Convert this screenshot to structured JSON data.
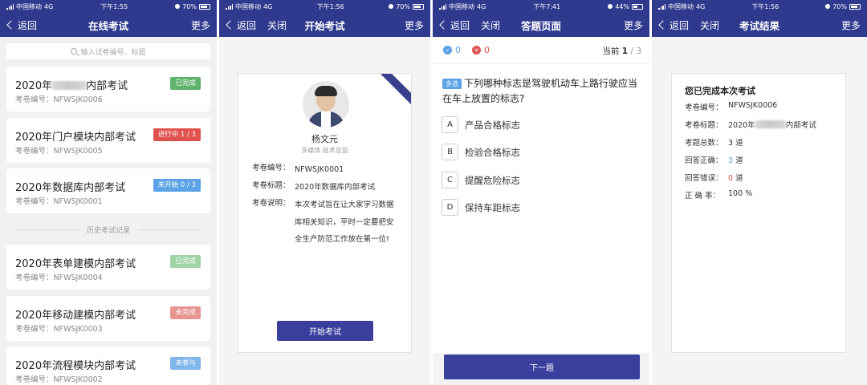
{
  "colors": {
    "primary": "#2f3a8f",
    "button": "#3a3f9e",
    "completed": "#5fb36b",
    "in_progress": "#e0524e",
    "not_started": "#5ba3e6",
    "completed_faded": "#9fd4a6",
    "incomplete": "#e79390",
    "not_attended": "#7fb6ec",
    "correct": "#5ba3e6",
    "wrong": "#e0524e"
  },
  "screens": [
    {
      "status": {
        "carrier": "中国移动",
        "network": "4G",
        "time": "下午1:55",
        "battery": "70%",
        "battery_level": 0.7
      },
      "nav": {
        "back": "返回",
        "title": "在线考试",
        "more": "更多"
      },
      "search": {
        "placeholder": "输入试卷编号、标题"
      },
      "history_label": "历史考试记录",
      "exams": [
        {
          "title_pre": "2020年",
          "title_post": "内部考试",
          "redacted": true,
          "code_label": "考卷编号：",
          "code": "NFWSJK0006",
          "badge": "已完成",
          "badge_color": "#5fb36b"
        },
        {
          "title_pre": "2020年门户模块内部考试",
          "title_post": "",
          "redacted": false,
          "code_label": "考卷编号：",
          "code": "NFWSJK0005",
          "badge": "进行中 1 / 3",
          "badge_color": "#e0524e"
        },
        {
          "title_pre": "2020年数据库内部考试",
          "title_post": "",
          "redacted": false,
          "code_label": "考卷编号：",
          "code": "NFWSJK0001",
          "badge": "未开始 0 / 3",
          "badge_color": "#5ba3e6"
        }
      ],
      "history": [
        {
          "title": "2020年表单建模内部考试",
          "code_label": "考卷编号：",
          "code": "NFWSJK0004",
          "badge": "已完成",
          "badge_color": "#9fd4a6"
        },
        {
          "title": "2020年移动建模内部考试",
          "code_label": "考卷编号：",
          "code": "NFWSJK0003",
          "badge": "未完成",
          "badge_color": "#e79390"
        },
        {
          "title": "2020年流程模块内部考试",
          "code_label": "考卷编号：",
          "code": "NFWSJK0002",
          "badge": "未参与",
          "badge_color": "#7fb6ec"
        }
      ]
    },
    {
      "status": {
        "carrier": "中国移动",
        "network": "4G",
        "time": "下午1:56",
        "battery": "70%",
        "battery_level": 0.7
      },
      "nav": {
        "back": "返回",
        "close": "关闭",
        "title": "开始考试",
        "more": "更多"
      },
      "person": {
        "name": "杨文元",
        "role": "多媒体  技术总监"
      },
      "fields": [
        {
          "label": "考卷编号：",
          "value": "NFWSJK0001"
        },
        {
          "label": "考卷标题：",
          "value": "2020年数据库内部考试"
        },
        {
          "label": "考卷说明：",
          "value": "本次考试旨在让大家学习数据库相关知识，平时一定要把安全生产防范工作放在第一位!"
        }
      ],
      "start_button": "开始考试"
    },
    {
      "status": {
        "carrier": "中国移动",
        "network": "4G",
        "time": "下午7:41",
        "battery": "44%",
        "battery_level": 0.44
      },
      "nav": {
        "back": "返回",
        "close": "关闭",
        "title": "答题页面",
        "more": "更多"
      },
      "score": {
        "correct": "0",
        "wrong": "0",
        "current_label": "当前",
        "current": "1",
        "sep": "/",
        "total": "3"
      },
      "question": {
        "tag": "多选",
        "text": "下列哪种标志是驾驶机动车上路行驶应当在车上放置的标志?"
      },
      "options": [
        {
          "letter": "A",
          "text": "产品合格标志"
        },
        {
          "letter": "B",
          "text": "检验合格标志"
        },
        {
          "letter": "C",
          "text": "提醒危险标志"
        },
        {
          "letter": "D",
          "text": "保持车距标志"
        }
      ],
      "next_button": "下一题"
    },
    {
      "status": {
        "carrier": "中国移动",
        "network": "4G",
        "time": "下午1:56",
        "battery": "70%",
        "battery_level": 0.7
      },
      "nav": {
        "back": "返回",
        "close": "关闭",
        "title": "考试结果",
        "more": "更多"
      },
      "result": {
        "title": "您已完成本次考试",
        "code_label": "考卷编号：",
        "code": "NFWSJK0006",
        "title_label": "考卷标题：",
        "title_pre": "2020年",
        "title_post": "内部考试",
        "total_label": "考题总数：",
        "total": "3",
        "total_unit": "道",
        "correct_label": "回答正确：",
        "correct": "3",
        "correct_unit": "道",
        "wrong_label": "回答错误：",
        "wrong": "0",
        "wrong_unit": "道",
        "rate_label": "正 确 率：",
        "rate": "100 %"
      }
    }
  ]
}
